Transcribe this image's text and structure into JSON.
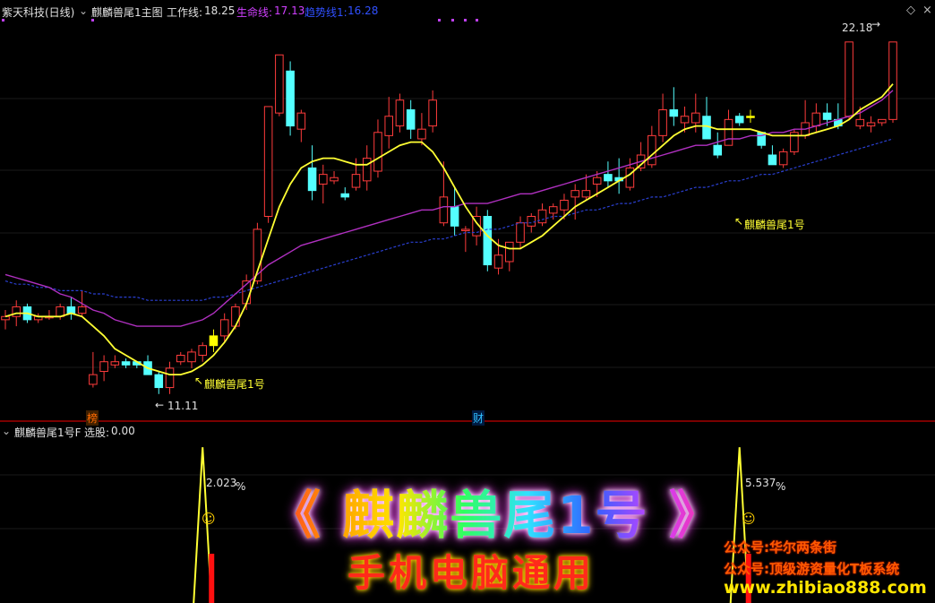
{
  "header": {
    "stock_title": "紫天科技(日线)",
    "indicator_name": "麒麟兽尾1主图",
    "work_line_label": "工作线:",
    "work_line_value": "18.25",
    "life_line_label": "生命线:",
    "life_line_value": "17.13",
    "trend_line_label": "趋势线1:",
    "trend_line_value": "16.28"
  },
  "sub_header": {
    "indicator_name": "麒麟兽尾1号F",
    "select_label": "选股:",
    "select_value": "0.00"
  },
  "annotations": {
    "high_price": "22.18",
    "low_price": "11.11",
    "signal_label_1": "麒麟兽尾1号",
    "signal_label_2": "麒麟兽尾1号",
    "event_tag_1": "榜",
    "event_tag_2": "财",
    "pct_1": "2.023",
    "pct_2": "5.537",
    "pct_unit": "%"
  },
  "promo": {
    "title": "《 麒麟兽尾1号 》",
    "subtitle": "手机电脑通用",
    "line1": "公众号:华尔两条街",
    "line2": "公众号:顶级游资量化T板系统",
    "site": "www.zhibiao888.com"
  },
  "colors": {
    "up": "#ff3c3c",
    "down": "#54ffff",
    "work_line": "#ffff33",
    "life_line": "#b030c0",
    "trend_line": "#2a3fd0",
    "signal": "#ffff00",
    "divider": "#7a0000"
  },
  "chart_data": {
    "type": "candlestick",
    "x": [
      1,
      2,
      3,
      4,
      5,
      6,
      7,
      8,
      9,
      10,
      11,
      12,
      13,
      14,
      15,
      16,
      17,
      18,
      19,
      20,
      21,
      22,
      23,
      24,
      25,
      26,
      27,
      28,
      29,
      30,
      31,
      32,
      33,
      34,
      35,
      36,
      37,
      38,
      39,
      40,
      41,
      42,
      43,
      44,
      45,
      46,
      47,
      48,
      49,
      50,
      51,
      52,
      53,
      54,
      55,
      56,
      57,
      58,
      59,
      60,
      61,
      62,
      63,
      64,
      65,
      66,
      67,
      68,
      69,
      70,
      71,
      72,
      73,
      74,
      75,
      76,
      77,
      78,
      79,
      80,
      81,
      82
    ],
    "ohlc": [
      [
        13.6,
        13.9,
        13.3,
        13.7
      ],
      [
        13.7,
        14.2,
        13.4,
        14.0
      ],
      [
        14.0,
        14.1,
        13.5,
        13.6
      ],
      [
        13.6,
        13.8,
        13.5,
        13.7
      ],
      [
        13.7,
        13.9,
        13.6,
        13.7
      ],
      [
        13.7,
        14.1,
        13.6,
        14.0
      ],
      [
        14.0,
        14.3,
        13.6,
        13.8
      ],
      [
        13.8,
        14.5,
        13.7,
        14.0
      ],
      [
        11.6,
        12.6,
        11.5,
        11.9
      ],
      [
        12.0,
        12.5,
        11.7,
        12.3
      ],
      [
        12.2,
        12.5,
        12.1,
        12.3
      ],
      [
        12.3,
        12.4,
        12.1,
        12.2
      ],
      [
        12.3,
        12.3,
        12.1,
        12.2
      ],
      [
        12.3,
        12.5,
        11.9,
        11.9
      ],
      [
        11.9,
        12.0,
        11.3,
        11.5
      ],
      [
        11.5,
        12.3,
        11.3,
        12.1
      ],
      [
        12.3,
        12.6,
        12.2,
        12.5
      ],
      [
        12.3,
        12.7,
        12.1,
        12.6
      ],
      [
        12.5,
        12.9,
        12.3,
        12.8
      ],
      [
        12.8,
        13.3,
        12.6,
        13.1
      ],
      [
        13.1,
        13.8,
        12.9,
        13.6
      ],
      [
        13.4,
        14.1,
        13.3,
        14.0
      ],
      [
        14.1,
        15.0,
        13.9,
        14.8
      ],
      [
        14.8,
        16.6,
        14.7,
        16.4
      ],
      [
        16.8,
        20.2,
        16.6,
        20.2
      ],
      [
        20.0,
        21.8,
        19.9,
        21.8
      ],
      [
        21.3,
        21.6,
        19.3,
        19.6
      ],
      [
        19.5,
        20.1,
        19.1,
        20.0
      ],
      [
        18.3,
        19.0,
        17.3,
        17.6
      ],
      [
        17.8,
        18.4,
        17.2,
        18.1
      ],
      [
        17.9,
        18.2,
        17.8,
        18.0
      ],
      [
        17.5,
        17.7,
        17.3,
        17.4
      ],
      [
        17.7,
        18.6,
        17.6,
        18.1
      ],
      [
        17.9,
        19.0,
        17.6,
        18.6
      ],
      [
        18.2,
        19.8,
        18.0,
        19.4
      ],
      [
        19.3,
        20.5,
        18.9,
        19.9
      ],
      [
        19.6,
        20.6,
        19.4,
        20.4
      ],
      [
        20.1,
        20.4,
        19.2,
        19.5
      ],
      [
        19.2,
        20.0,
        19.0,
        19.5
      ],
      [
        19.6,
        20.7,
        19.4,
        20.4
      ],
      [
        16.6,
        18.5,
        16.5,
        17.4
      ],
      [
        17.1,
        17.7,
        16.2,
        16.5
      ],
      [
        16.4,
        16.5,
        15.7,
        16.4
      ],
      [
        16.2,
        17.1,
        15.9,
        16.8
      ],
      [
        16.8,
        17.0,
        15.1,
        15.3
      ],
      [
        15.2,
        16.1,
        15.0,
        15.6
      ],
      [
        15.4,
        16.0,
        15.1,
        16.0
      ],
      [
        16.0,
        16.8,
        15.8,
        16.6
      ],
      [
        16.5,
        16.9,
        16.3,
        16.8
      ],
      [
        16.6,
        17.2,
        16.5,
        17.0
      ],
      [
        16.9,
        17.2,
        16.7,
        17.1
      ],
      [
        17.0,
        17.5,
        16.7,
        17.3
      ],
      [
        17.4,
        17.8,
        16.7,
        17.6
      ],
      [
        17.4,
        18.1,
        17.3,
        17.6
      ],
      [
        17.8,
        18.2,
        17.4,
        18.0
      ],
      [
        18.1,
        18.5,
        17.7,
        17.9
      ],
      [
        18.0,
        18.6,
        17.5,
        17.9
      ],
      [
        17.7,
        18.6,
        17.6,
        18.3
      ],
      [
        18.3,
        19.1,
        18.2,
        18.7
      ],
      [
        18.4,
        19.6,
        18.3,
        19.3
      ],
      [
        19.3,
        20.6,
        19.1,
        20.1
      ],
      [
        20.1,
        20.8,
        19.6,
        19.9
      ],
      [
        19.7,
        20.2,
        19.4,
        19.9
      ],
      [
        19.7,
        20.6,
        19.4,
        20.0
      ],
      [
        19.9,
        20.5,
        19.2,
        19.2
      ],
      [
        19.0,
        19.4,
        18.6,
        18.7
      ],
      [
        19.0,
        20.1,
        19.0,
        19.8
      ],
      [
        19.9,
        20.0,
        19.6,
        19.7
      ],
      [
        19.9,
        20.1,
        19.7,
        19.9
      ],
      [
        19.4,
        19.4,
        18.9,
        19.0
      ],
      [
        18.7,
        19.0,
        18.4,
        18.4
      ],
      [
        18.4,
        18.9,
        18.3,
        18.8
      ],
      [
        18.8,
        19.5,
        18.7,
        19.4
      ],
      [
        19.3,
        20.4,
        19.2,
        19.7
      ],
      [
        19.6,
        20.3,
        19.4,
        20.0
      ],
      [
        20.0,
        20.3,
        19.6,
        19.8
      ],
      [
        19.8,
        20.3,
        19.5,
        19.6
      ],
      [
        19.9,
        22.2,
        19.8,
        22.2
      ],
      [
        19.6,
        20.2,
        19.5,
        19.8
      ],
      [
        19.6,
        19.9,
        19.4,
        19.7
      ],
      [
        19.7,
        19.8,
        19.6,
        19.8
      ],
      [
        19.8,
        22.2,
        19.7,
        22.2
      ]
    ],
    "work_line": [
      13.7,
      13.8,
      13.8,
      13.7,
      13.7,
      13.7,
      13.8,
      13.7,
      13.4,
      13.1,
      12.7,
      12.5,
      12.3,
      12.1,
      12.0,
      11.9,
      11.9,
      12.0,
      12.2,
      12.5,
      12.9,
      13.4,
      14.1,
      15.1,
      16.1,
      17.1,
      17.8,
      18.3,
      18.5,
      18.6,
      18.6,
      18.5,
      18.4,
      18.4,
      18.6,
      18.8,
      19.0,
      19.1,
      19.1,
      18.8,
      18.3,
      17.7,
      17.1,
      16.6,
      16.2,
      15.9,
      15.8,
      15.8,
      16.0,
      16.2,
      16.5,
      16.8,
      17.1,
      17.3,
      17.5,
      17.7,
      17.9,
      18.1,
      18.4,
      18.7,
      19.0,
      19.3,
      19.5,
      19.6,
      19.6,
      19.5,
      19.5,
      19.5,
      19.5,
      19.4,
      19.3,
      19.3,
      19.3,
      19.3,
      19.4,
      19.5,
      19.6,
      19.8,
      20.1,
      20.3,
      20.5,
      20.9
    ],
    "life_line": [
      15.0,
      14.9,
      14.8,
      14.7,
      14.6,
      14.4,
      14.3,
      14.1,
      13.9,
      13.8,
      13.6,
      13.5,
      13.4,
      13.4,
      13.4,
      13.4,
      13.4,
      13.5,
      13.6,
      13.8,
      14.1,
      14.4,
      14.7,
      15.0,
      15.3,
      15.5,
      15.7,
      15.9,
      16.0,
      16.1,
      16.2,
      16.3,
      16.4,
      16.5,
      16.6,
      16.7,
      16.8,
      16.9,
      17.0,
      17.0,
      17.1,
      17.1,
      17.2,
      17.2,
      17.2,
      17.3,
      17.4,
      17.5,
      17.5,
      17.6,
      17.7,
      17.8,
      17.9,
      18.0,
      18.1,
      18.2,
      18.3,
      18.4,
      18.5,
      18.6,
      18.7,
      18.8,
      18.9,
      19.0,
      19.0,
      19.1,
      19.2,
      19.2,
      19.3,
      19.3,
      19.4,
      19.4,
      19.5,
      19.5,
      19.6,
      19.7,
      19.8,
      19.9,
      20.0,
      20.2,
      20.4,
      20.7
    ],
    "trend_line": [
      14.8,
      14.7,
      14.7,
      14.6,
      14.6,
      14.5,
      14.5,
      14.5,
      14.4,
      14.4,
      14.3,
      14.3,
      14.3,
      14.2,
      14.2,
      14.2,
      14.2,
      14.2,
      14.2,
      14.3,
      14.3,
      14.4,
      14.5,
      14.6,
      14.7,
      14.8,
      14.9,
      15.0,
      15.1,
      15.2,
      15.3,
      15.4,
      15.5,
      15.6,
      15.7,
      15.8,
      15.9,
      16.0,
      16.0,
      16.1,
      16.1,
      16.2,
      16.3,
      16.3,
      16.4,
      16.4,
      16.5,
      16.6,
      16.6,
      16.7,
      16.8,
      16.8,
      16.9,
      17.0,
      17.0,
      17.1,
      17.2,
      17.2,
      17.3,
      17.4,
      17.4,
      17.5,
      17.6,
      17.7,
      17.7,
      17.8,
      17.9,
      17.9,
      18.0,
      18.1,
      18.1,
      18.2,
      18.3,
      18.4,
      18.5,
      18.6,
      18.7,
      18.8,
      18.9,
      19.0,
      19.1,
      19.2
    ],
    "signal_bars": [
      19,
      68
    ],
    "ylim": [
      10.6,
      23.0
    ],
    "sub_panel": {
      "spikes": [
        {
          "x": 18,
          "value": 2.023,
          "red_bar": true
        },
        {
          "x": 67,
          "value": 5.537,
          "red_bar": true
        }
      ]
    }
  }
}
